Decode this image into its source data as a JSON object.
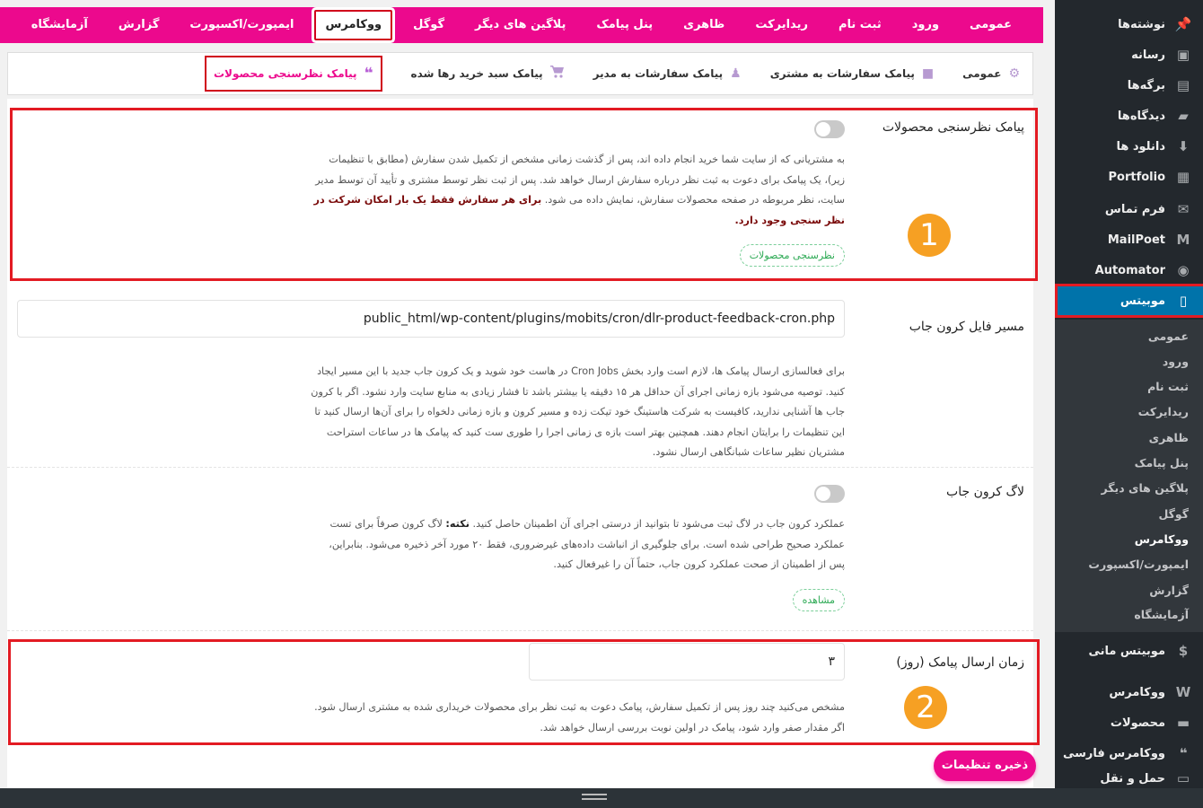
{
  "top_tabs": [
    {
      "label": "عمومی",
      "active": false
    },
    {
      "label": "ورود",
      "active": false
    },
    {
      "label": "ثبت نام",
      "active": false
    },
    {
      "label": "ریدایرکت",
      "active": false
    },
    {
      "label": "ظاهری",
      "active": false
    },
    {
      "label": "پنل پیامک",
      "active": false
    },
    {
      "label": "پلاگین های دیگر",
      "active": false
    },
    {
      "label": "گوگل",
      "active": false
    },
    {
      "label": "ووکامرس",
      "active": true
    },
    {
      "label": "ایمپورت/اکسپورت",
      "active": false
    },
    {
      "label": "گزارش",
      "active": false
    },
    {
      "label": "آزمایشگاه",
      "active": false
    }
  ],
  "sub_tabs": [
    {
      "label": "عمومی",
      "icon": "gear-icon",
      "active": false
    },
    {
      "label": "پیامک سفارشات به مشتری",
      "icon": "chat-bubble-icon",
      "active": false
    },
    {
      "label": "پیامک سفارشات به مدیر",
      "icon": "user-icon",
      "active": false
    },
    {
      "label": "پیامک سبد خرید رها شده",
      "icon": "cart-icon",
      "active": false
    },
    {
      "label": "پیامک نظرسنجی محصولات",
      "icon": "quote-icon",
      "active": true
    }
  ],
  "feedback": {
    "label": "پیامک نظرسنجی محصولات",
    "toggle_on": false,
    "desc_plain": "به مشتریانی که از سایت شما خرید انجام داده اند، پس از گذشت زمانی مشخص از تکمیل شدن سفارش (مطابق با تنظیمات زیر)، یک پیامک برای دعوت به ثبت نظر درباره سفارش ارسال خواهد شد. پس از ثبت نظر توسط مشتری و تأیید آن توسط مدیر سایت، نظر مربوطه در صفحه محصولات سفارش، نمایش داده می شود.",
    "desc_bold": "برای هر سفارش فقط یک بار امکان شرکت در نظر سنجی وجود دارد.",
    "pill": "نظرسنجی محصولات",
    "badge": "1"
  },
  "cron_path": {
    "label": "مسیر فایل کرون جاب",
    "value": "public_html/wp-content/plugins/mobits/cron/dlr-product-feedback-cron.php",
    "desc": "برای فعالسازی ارسال پیامک ها، لازم است وارد بخش Cron Jobs در هاست خود شوید و یک کرون جاب جدید با این مسیر ایجاد کنید. توصیه می‌شود بازه زمانی اجرای آن حداقل هر ۱۵ دقیقه یا بیشتر باشد تا فشار زیادی به منابع سایت وارد نشود. اگر با کرون جاب ها آشنایی ندارید، کافیست به شرکت هاستینگ خود تیکت زده و مسیر کرون و بازه زمانی دلخواه را برای آن‌ها ارسال کنید تا این تنظیمات را برایتان انجام دهند. همچنین بهتر است بازه ی زمانی اجرا را طوری ست کنید که پیامک ها در ساعات استراحت مشتریان نظیر ساعات شبانگاهی ارسال نشود."
  },
  "cron_log": {
    "label": "لاگ کرون جاب",
    "toggle_on": false,
    "desc_a": "عملکرد کرون جاب در لاگ ثبت می‌شود تا بتوانید از درستی اجرای آن اطمینان حاصل کنید.",
    "note_label": "نکته:",
    "desc_b": "لاگ کرون صرفاً برای تست عملکرد صحیح طراحی شده است. برای جلوگیری از انباشت داده‌های غیرضروری، فقط ۲۰ مورد آخر ذخیره می‌شود. بنابراین، پس از اطمینان از صحت عملکرد کرون جاب، حتماً آن را غیرفعال کنید.",
    "pill": "مشاهده"
  },
  "send_time": {
    "label": "زمان ارسال پیامک (روز)",
    "value": "۳",
    "desc": "مشخص می‌کنید چند روز پس از تکمیل سفارش، پیامک دعوت به ثبت نظر برای محصولات خریداری شده به مشتری ارسال شود. اگر مقدار صفر وارد شود، پیامک در اولین نوبت بررسی ارسال خواهد شد.",
    "badge": "2"
  },
  "save_label": "ذخیره تنظیمات",
  "sidebar_top": [
    {
      "label": "نوشته‌ها",
      "icon": "pin-icon"
    },
    {
      "label": "رسانه",
      "icon": "media-icon"
    },
    {
      "label": "برگه‌ها",
      "icon": "pages-icon"
    },
    {
      "label": "دیدگاه‌ها",
      "icon": "comment-icon"
    },
    {
      "label": "دانلود ها",
      "icon": "download-icon"
    },
    {
      "label": "Portfolio",
      "icon": "grid-icon"
    },
    {
      "label": "فرم تماس",
      "icon": "mail-icon"
    },
    {
      "label": "MailPoet",
      "icon": "mailpoet-icon"
    },
    {
      "label": "Automator",
      "icon": "automator-icon"
    },
    {
      "label": "موبیتس",
      "icon": "mobile-icon"
    }
  ],
  "sidebar_sub": [
    {
      "label": "عمومی"
    },
    {
      "label": "ورود"
    },
    {
      "label": "ثبت نام"
    },
    {
      "label": "ریدایرکت"
    },
    {
      "label": "ظاهری"
    },
    {
      "label": "پنل پیامک"
    },
    {
      "label": "پلاگین های دیگر"
    },
    {
      "label": "گوگل"
    },
    {
      "label": "ووکامرس"
    },
    {
      "label": "ایمپورت/اکسپورت"
    },
    {
      "label": "گزارش"
    },
    {
      "label": "آزمایشگاه"
    }
  ],
  "sidebar_bottom": [
    {
      "label": "موبیتس مانی",
      "icon": "dollar-icon"
    },
    {
      "label": "ووکامرس",
      "icon": "woo-icon"
    },
    {
      "label": "محصولات",
      "icon": "products-icon"
    },
    {
      "label": "ووکامرس فارسی",
      "icon": "quote-icon"
    },
    {
      "label": "حمل و نقل",
      "icon": "truck-icon"
    }
  ],
  "colors": {
    "brand": "#ec098d",
    "highlight": "#e31b23",
    "badge": "#f6a023",
    "admin_bg": "#23282d",
    "admin_active": "#0073aa"
  }
}
